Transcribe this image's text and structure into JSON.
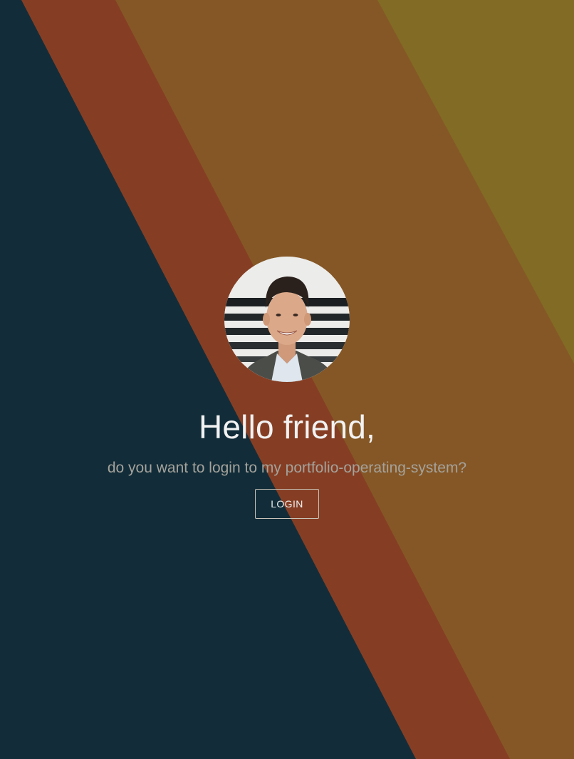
{
  "theme": {
    "stripe_navy": "#122d39",
    "stripe_rust": "#853e24",
    "stripe_orange": "#855726",
    "stripe_olive": "#826b24",
    "text_light": "#f2f2f2",
    "text_muted": "#a4a29b",
    "button_border": "#c9c3b8"
  },
  "profile": {
    "avatar_icon": "profile-photo"
  },
  "login": {
    "greeting": "Hello friend,",
    "subtitle": "do you want to login to my portfolio-operating-system?",
    "button_label": "LOGIN"
  }
}
